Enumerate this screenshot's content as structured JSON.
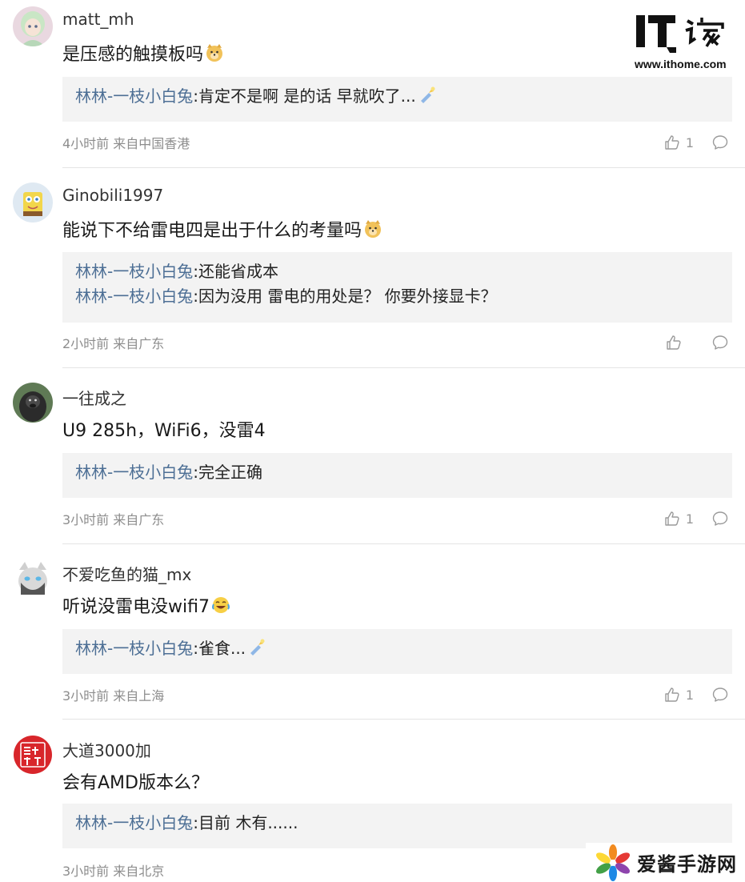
{
  "logos": {
    "top": {
      "text": "IT之家",
      "url": "www.ithome.com"
    },
    "bottom": {
      "text": "爱酱手游网"
    }
  },
  "comments": [
    {
      "username": "matt_mh",
      "content": "是压感的触摸板吗",
      "replies": [
        {
          "author": "林林-一枝小白兔",
          "text": ":肯定不是啊 是的话 早就吹了..."
        }
      ],
      "meta": "4小时前 来自中国香港",
      "likes": "1"
    },
    {
      "username": "Ginobili1997",
      "content": "能说下不给雷电四是出于什么的考量吗",
      "replies": [
        {
          "author": "林林-一枝小白兔",
          "text": ":还能省成本"
        },
        {
          "author": "林林-一枝小白兔",
          "text": ":因为没用 雷电的用处是？ 你要外接显卡？"
        }
      ],
      "meta": "2小时前 来自广东",
      "likes": ""
    },
    {
      "username": "一往成之",
      "content": "U9 285h，WiFi6，没雷4",
      "replies": [
        {
          "author": "林林-一枝小白兔",
          "text": ":完全正确"
        }
      ],
      "meta": "3小时前 来自广东",
      "likes": "1"
    },
    {
      "username": "不爱吃鱼的猫_mx",
      "content": "听说没雷电没wifi7",
      "replies": [
        {
          "author": "林林-一枝小白兔",
          "text": ":雀食..."
        }
      ],
      "meta": "3小时前 来自上海",
      "likes": "1"
    },
    {
      "username": "大道3000加",
      "content": "会有AMD版本么？",
      "replies": [
        {
          "author": "林林-一枝小白兔",
          "text": ":目前 木有......"
        }
      ],
      "meta": "3小时前 来自北京",
      "likes": ""
    }
  ]
}
